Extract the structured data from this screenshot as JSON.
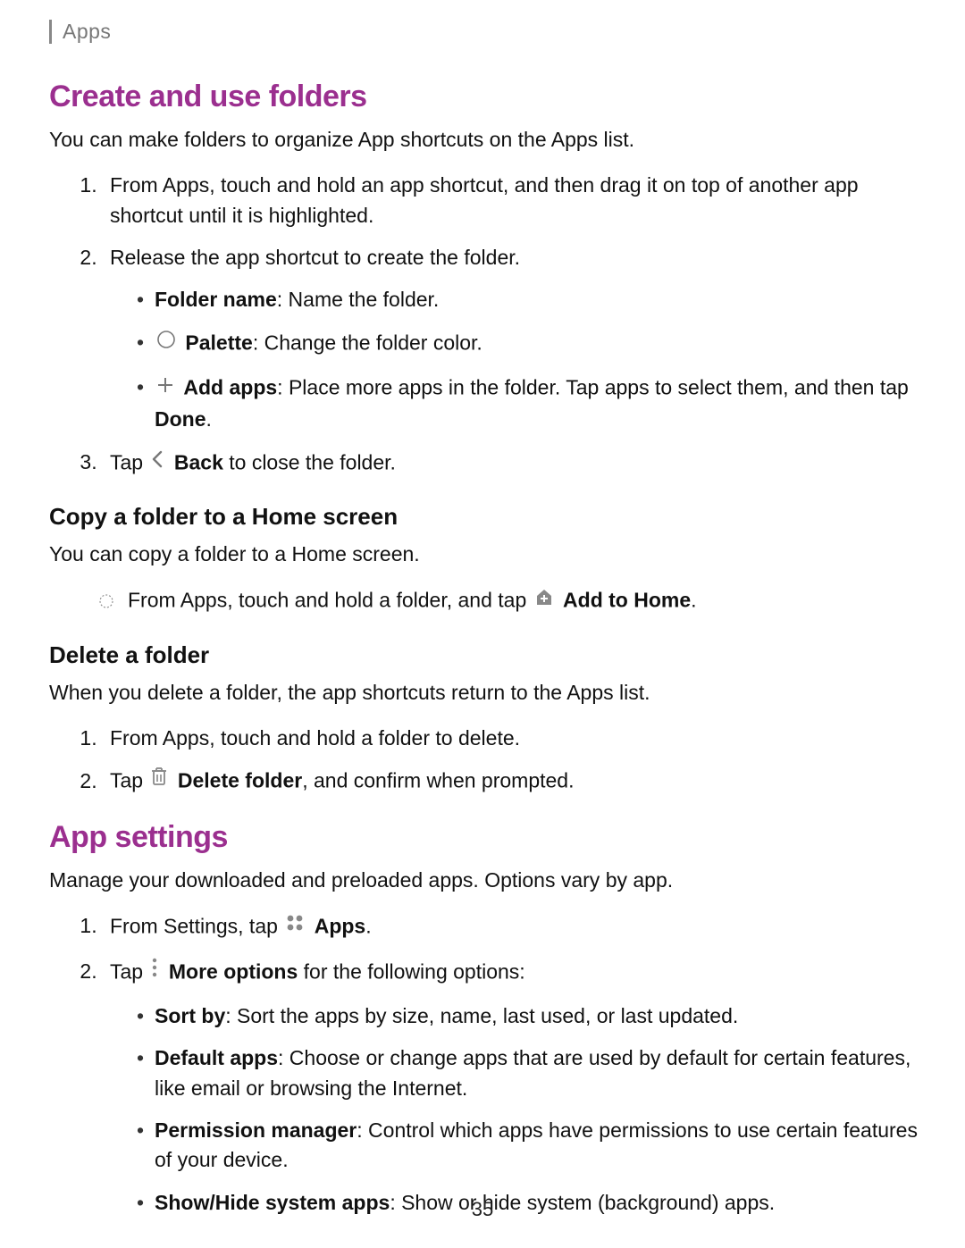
{
  "breadcrumb": "Apps",
  "pageNumber": "35",
  "section1": {
    "title": "Create and use folders",
    "intro": "You can make folders to organize App shortcuts on the Apps list.",
    "step1": "From Apps, touch and hold an app shortcut, and then drag it on top of another app shortcut until it is highlighted.",
    "step2": "Release the app shortcut to create the folder.",
    "bullets": {
      "folderName": {
        "label": "Folder name",
        "text": ": Name the folder."
      },
      "palette": {
        "label": "Palette",
        "text": ": Change the folder color."
      },
      "addApps": {
        "label": "Add apps",
        "text": ": Place more apps in the folder. Tap apps to select them, and then tap ",
        "tail": "Done",
        "tail2": "."
      }
    },
    "step3": {
      "pre": "Tap ",
      "label": "Back",
      "post": " to close the folder."
    },
    "sub1": {
      "title": "Copy a folder to a Home screen",
      "intro": "You can copy a folder to a Home screen.",
      "line": {
        "pre": "From Apps, touch and hold a folder, and tap ",
        "label": "Add to Home",
        "post": "."
      }
    },
    "sub2": {
      "title": "Delete a folder",
      "intro": "When you delete a folder, the app shortcuts return to the Apps list.",
      "step1": "From Apps, touch and hold a folder to delete.",
      "step2": {
        "pre": "Tap ",
        "label": "Delete folder",
        "post": ", and confirm when prompted."
      }
    }
  },
  "section2": {
    "title": "App settings",
    "intro": "Manage your downloaded and preloaded apps. Options vary by app.",
    "step1": {
      "pre": "From Settings, tap ",
      "label": "Apps",
      "post": "."
    },
    "step2": {
      "pre": "Tap ",
      "label": "More options",
      "post": " for the following options:"
    },
    "bullets": {
      "sort": {
        "label": "Sort by",
        "text": ": Sort the apps by size, name, last used, or last updated."
      },
      "default": {
        "label": "Default apps",
        "text": ": Choose or change apps that are used by default for certain features, like email or browsing the Internet."
      },
      "perm": {
        "label": "Permission manager",
        "text": ": Control which apps have permissions to use certain features of your device."
      },
      "showhide": {
        "label": "Show/Hide system apps",
        "text": ": Show or hide system (background) apps."
      }
    }
  }
}
